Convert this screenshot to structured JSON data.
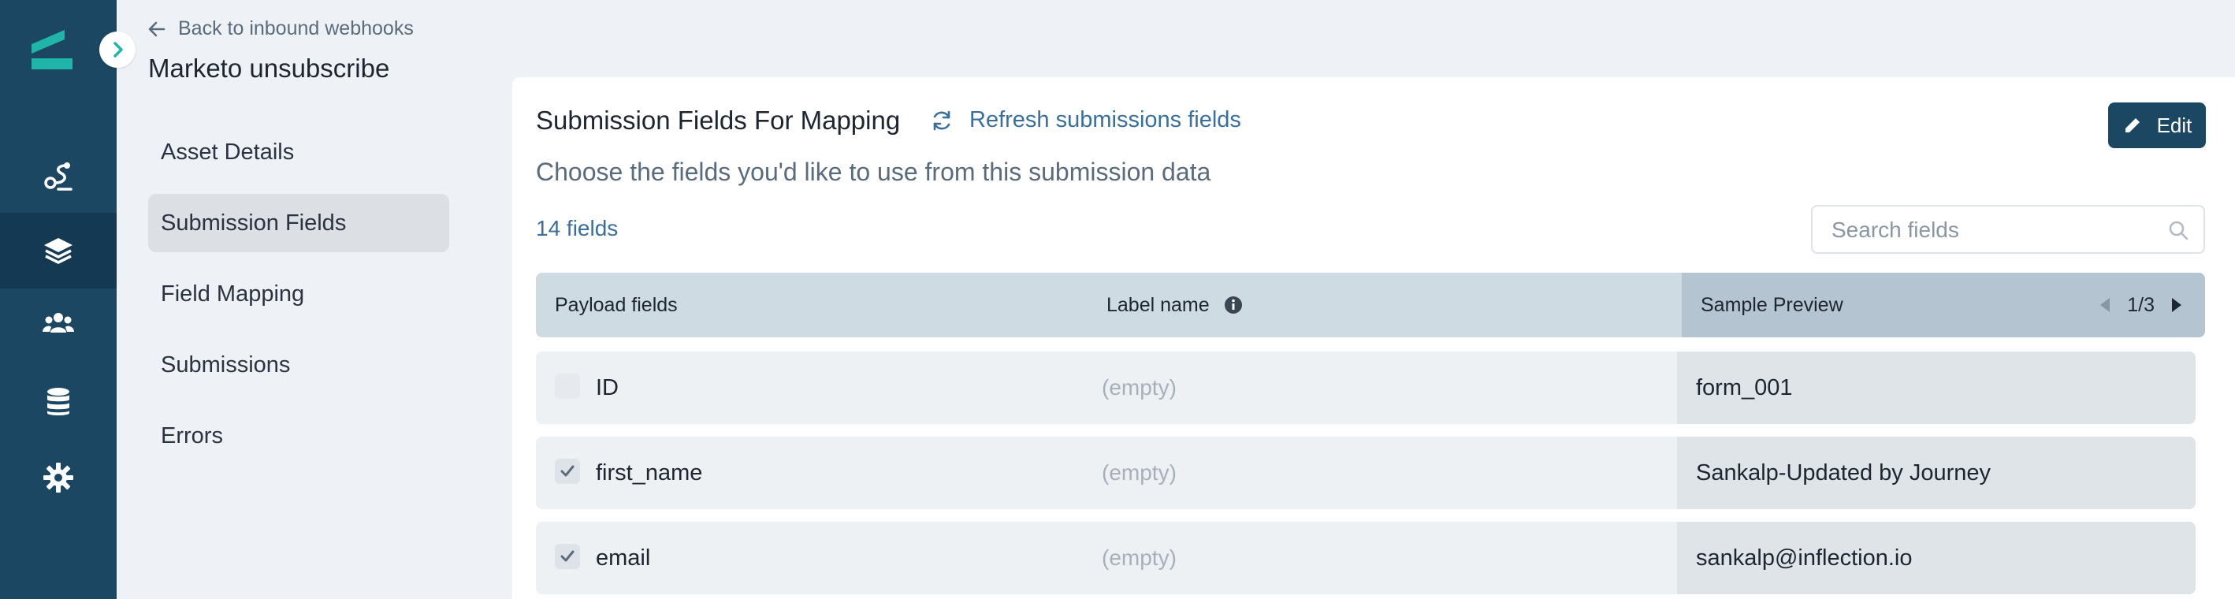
{
  "app": {
    "icons": {
      "logo": "inflection-logo-icon",
      "rail": [
        "journey-icon",
        "layers-icon",
        "users-icon",
        "database-icon",
        "gear-icon"
      ],
      "toggle": "chevron-right-icon"
    },
    "colors": {
      "rail": "#1b4763",
      "accent": "#1fb5a8",
      "primary_button": "#1b4763",
      "link": "#3a6e9c"
    }
  },
  "header": {
    "back_label": "Back to inbound webhooks",
    "title": "Marketo unsubscribe"
  },
  "nav": {
    "items": [
      {
        "label": "Asset Details"
      },
      {
        "label": "Submission Fields"
      },
      {
        "label": "Field Mapping"
      },
      {
        "label": "Submissions"
      },
      {
        "label": "Errors"
      }
    ],
    "active_index": 1
  },
  "main": {
    "title": "Submission Fields For Mapping",
    "refresh_label": "Refresh submissions fields",
    "edit_label": "Edit",
    "subtitle": "Choose the fields you'd like to use from this submission data",
    "field_count": "14 fields",
    "search_placeholder": "Search fields"
  },
  "table": {
    "columns": {
      "payload": "Payload fields",
      "label": "Label name",
      "sample": "Sample Preview"
    },
    "pager": "1/3",
    "rows": [
      {
        "name": "ID",
        "label": "(empty)",
        "sample": "form_001",
        "checked": false,
        "disabled": true
      },
      {
        "name": "first_name",
        "label": "(empty)",
        "sample": "Sankalp-Updated by Journey",
        "checked": true,
        "disabled": false
      },
      {
        "name": "email",
        "label": "(empty)",
        "sample": "sankalp@inflection.io",
        "checked": true,
        "disabled": false
      }
    ]
  }
}
